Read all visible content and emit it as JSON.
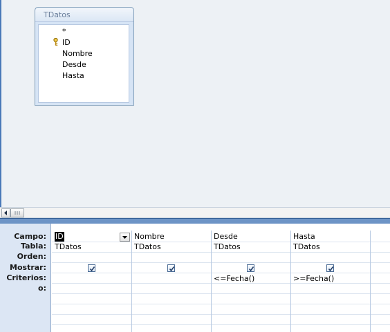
{
  "table": {
    "title": "TDatos",
    "fields": [
      "*",
      "ID",
      "Nombre",
      "Desde",
      "Hasta"
    ]
  },
  "grid": {
    "row_labels": [
      "Campo:",
      "Tabla:",
      "Orden:",
      "Mostrar:",
      "Criterios:",
      "o:"
    ],
    "columns": [
      {
        "campo": "ID",
        "tabla": "TDatos",
        "mostrar": true,
        "criterios": ""
      },
      {
        "campo": "Nombre",
        "tabla": "TDatos",
        "mostrar": true,
        "criterios": ""
      },
      {
        "campo": "Desde",
        "tabla": "TDatos",
        "mostrar": true,
        "criterios": "<=Fecha()"
      },
      {
        "campo": "Hasta",
        "tabla": "TDatos",
        "mostrar": true,
        "criterios": ">=Fecha()"
      }
    ]
  }
}
